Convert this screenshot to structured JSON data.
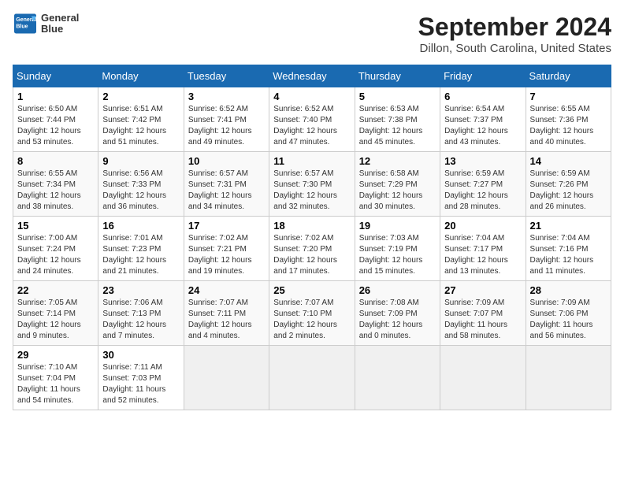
{
  "header": {
    "logo_line1": "General",
    "logo_line2": "Blue",
    "title": "September 2024",
    "subtitle": "Dillon, South Carolina, United States"
  },
  "days_of_week": [
    "Sunday",
    "Monday",
    "Tuesday",
    "Wednesday",
    "Thursday",
    "Friday",
    "Saturday"
  ],
  "weeks": [
    [
      {
        "day": "1",
        "sunrise": "6:50 AM",
        "sunset": "7:44 PM",
        "daylight": "12 hours and 53 minutes."
      },
      {
        "day": "2",
        "sunrise": "6:51 AM",
        "sunset": "7:42 PM",
        "daylight": "12 hours and 51 minutes."
      },
      {
        "day": "3",
        "sunrise": "6:52 AM",
        "sunset": "7:41 PM",
        "daylight": "12 hours and 49 minutes."
      },
      {
        "day": "4",
        "sunrise": "6:52 AM",
        "sunset": "7:40 PM",
        "daylight": "12 hours and 47 minutes."
      },
      {
        "day": "5",
        "sunrise": "6:53 AM",
        "sunset": "7:38 PM",
        "daylight": "12 hours and 45 minutes."
      },
      {
        "day": "6",
        "sunrise": "6:54 AM",
        "sunset": "7:37 PM",
        "daylight": "12 hours and 43 minutes."
      },
      {
        "day": "7",
        "sunrise": "6:55 AM",
        "sunset": "7:36 PM",
        "daylight": "12 hours and 40 minutes."
      }
    ],
    [
      {
        "day": "8",
        "sunrise": "6:55 AM",
        "sunset": "7:34 PM",
        "daylight": "12 hours and 38 minutes."
      },
      {
        "day": "9",
        "sunrise": "6:56 AM",
        "sunset": "7:33 PM",
        "daylight": "12 hours and 36 minutes."
      },
      {
        "day": "10",
        "sunrise": "6:57 AM",
        "sunset": "7:31 PM",
        "daylight": "12 hours and 34 minutes."
      },
      {
        "day": "11",
        "sunrise": "6:57 AM",
        "sunset": "7:30 PM",
        "daylight": "12 hours and 32 minutes."
      },
      {
        "day": "12",
        "sunrise": "6:58 AM",
        "sunset": "7:29 PM",
        "daylight": "12 hours and 30 minutes."
      },
      {
        "day": "13",
        "sunrise": "6:59 AM",
        "sunset": "7:27 PM",
        "daylight": "12 hours and 28 minutes."
      },
      {
        "day": "14",
        "sunrise": "6:59 AM",
        "sunset": "7:26 PM",
        "daylight": "12 hours and 26 minutes."
      }
    ],
    [
      {
        "day": "15",
        "sunrise": "7:00 AM",
        "sunset": "7:24 PM",
        "daylight": "12 hours and 24 minutes."
      },
      {
        "day": "16",
        "sunrise": "7:01 AM",
        "sunset": "7:23 PM",
        "daylight": "12 hours and 21 minutes."
      },
      {
        "day": "17",
        "sunrise": "7:02 AM",
        "sunset": "7:21 PM",
        "daylight": "12 hours and 19 minutes."
      },
      {
        "day": "18",
        "sunrise": "7:02 AM",
        "sunset": "7:20 PM",
        "daylight": "12 hours and 17 minutes."
      },
      {
        "day": "19",
        "sunrise": "7:03 AM",
        "sunset": "7:19 PM",
        "daylight": "12 hours and 15 minutes."
      },
      {
        "day": "20",
        "sunrise": "7:04 AM",
        "sunset": "7:17 PM",
        "daylight": "12 hours and 13 minutes."
      },
      {
        "day": "21",
        "sunrise": "7:04 AM",
        "sunset": "7:16 PM",
        "daylight": "12 hours and 11 minutes."
      }
    ],
    [
      {
        "day": "22",
        "sunrise": "7:05 AM",
        "sunset": "7:14 PM",
        "daylight": "12 hours and 9 minutes."
      },
      {
        "day": "23",
        "sunrise": "7:06 AM",
        "sunset": "7:13 PM",
        "daylight": "12 hours and 7 minutes."
      },
      {
        "day": "24",
        "sunrise": "7:07 AM",
        "sunset": "7:11 PM",
        "daylight": "12 hours and 4 minutes."
      },
      {
        "day": "25",
        "sunrise": "7:07 AM",
        "sunset": "7:10 PM",
        "daylight": "12 hours and 2 minutes."
      },
      {
        "day": "26",
        "sunrise": "7:08 AM",
        "sunset": "7:09 PM",
        "daylight": "12 hours and 0 minutes."
      },
      {
        "day": "27",
        "sunrise": "7:09 AM",
        "sunset": "7:07 PM",
        "daylight": "11 hours and 58 minutes."
      },
      {
        "day": "28",
        "sunrise": "7:09 AM",
        "sunset": "7:06 PM",
        "daylight": "11 hours and 56 minutes."
      }
    ],
    [
      {
        "day": "29",
        "sunrise": "7:10 AM",
        "sunset": "7:04 PM",
        "daylight": "11 hours and 54 minutes."
      },
      {
        "day": "30",
        "sunrise": "7:11 AM",
        "sunset": "7:03 PM",
        "daylight": "11 hours and 52 minutes."
      },
      null,
      null,
      null,
      null,
      null
    ]
  ]
}
